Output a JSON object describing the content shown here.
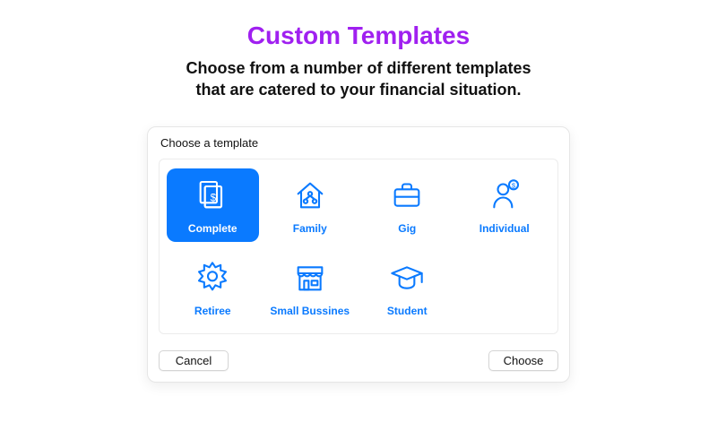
{
  "hero": {
    "title": "Custom Templates",
    "subtitle_line1": "Choose from a number of different templates",
    "subtitle_line2": "that are catered to your financial situation."
  },
  "dialog": {
    "title": "Choose a template",
    "templates": [
      {
        "label": "Complete",
        "icon": "documents-dollar-icon",
        "selected": true
      },
      {
        "label": "Family",
        "icon": "house-people-icon",
        "selected": false
      },
      {
        "label": "Gig",
        "icon": "briefcase-icon",
        "selected": false
      },
      {
        "label": "Individual",
        "icon": "person-dollar-icon",
        "selected": false
      },
      {
        "label": "Retiree",
        "icon": "sun-badge-icon",
        "selected": false
      },
      {
        "label": "Small Bussines",
        "icon": "storefront-icon",
        "selected": false
      },
      {
        "label": "Student",
        "icon": "graduation-cap-icon",
        "selected": false
      }
    ],
    "cancel_label": "Cancel",
    "choose_label": "Choose"
  },
  "colors": {
    "accent": "#0a7aff",
    "heading": "#a020f0"
  }
}
